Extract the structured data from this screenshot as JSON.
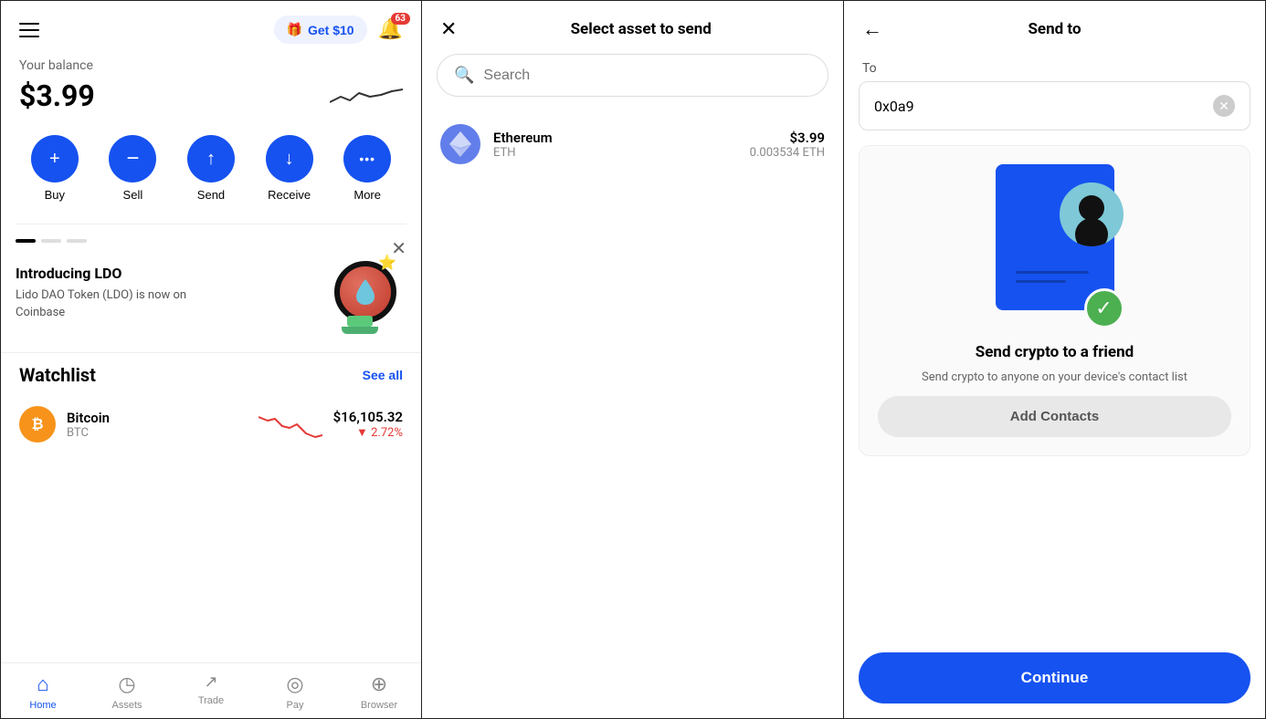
{
  "panel1": {
    "header": {
      "get_money_label": "Get $10",
      "notification_badge": "63"
    },
    "balance": {
      "label": "Your balance",
      "amount": "$3.99"
    },
    "actions": [
      {
        "id": "buy",
        "label": "Buy",
        "icon": "+"
      },
      {
        "id": "sell",
        "label": "Sell",
        "icon": "−"
      },
      {
        "id": "send",
        "label": "Send",
        "icon": "↑"
      },
      {
        "id": "receive",
        "label": "Receive",
        "icon": "↓"
      },
      {
        "id": "more",
        "label": "More",
        "icon": "•••"
      }
    ],
    "promo": {
      "title": "Introducing LDO",
      "description": "Lido DAO Token (LDO) is now on Coinbase"
    },
    "watchlist": {
      "title": "Watchlist",
      "see_all": "See all",
      "items": [
        {
          "name": "Bitcoin",
          "symbol": "BTC",
          "price": "$16,105.32",
          "change": "▼ 2.72%",
          "change_negative": true
        }
      ]
    },
    "nav": [
      {
        "id": "home",
        "label": "Home",
        "icon": "⌂",
        "active": true
      },
      {
        "id": "assets",
        "label": "Assets",
        "icon": "◷",
        "active": false
      },
      {
        "id": "trade",
        "label": "Trade",
        "icon": "↗",
        "active": false
      },
      {
        "id": "pay",
        "label": "Pay",
        "icon": "◎",
        "active": false
      },
      {
        "id": "browser",
        "label": "Browser",
        "icon": "⊕",
        "active": false
      }
    ]
  },
  "panel2": {
    "title": "Select asset to send",
    "search": {
      "placeholder": "Search"
    },
    "assets": [
      {
        "name": "Ethereum",
        "symbol": "ETH",
        "usd_value": "$3.99",
        "crypto_value": "0.003534 ETH"
      }
    ]
  },
  "panel3": {
    "title": "Send to",
    "to_label": "To",
    "address_value": "0x0a9",
    "send_friend": {
      "title": "Send crypto to a friend",
      "description": "Send crypto to anyone on your device's contact list",
      "add_contacts_label": "Add Contacts"
    },
    "continue_label": "Continue"
  }
}
